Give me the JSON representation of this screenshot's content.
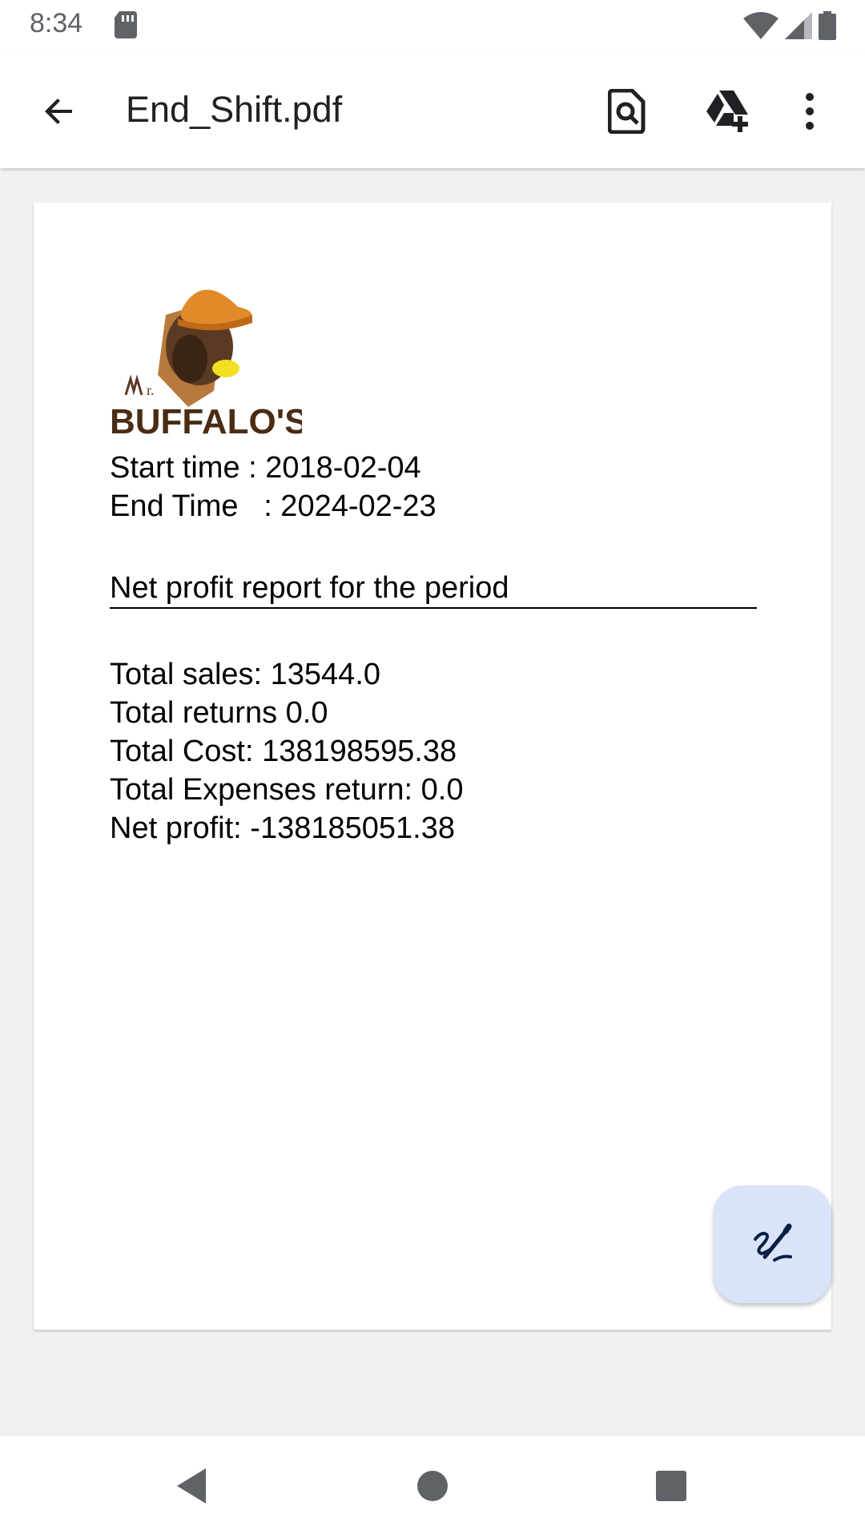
{
  "status_bar": {
    "time": "8:34",
    "icons": [
      "sd-card-icon",
      "wifi-icon",
      "signal-icon",
      "battery-icon"
    ]
  },
  "app_bar": {
    "title": "End_Shift.pdf",
    "icons": [
      "back-arrow-icon",
      "find-in-page-icon",
      "add-to-drive-icon",
      "more-vert-icon"
    ]
  },
  "document": {
    "logo_text": "Mr. BUFFALO'S",
    "start_time": "Start time : 2018-02-04",
    "end_time": "End Time   : 2024-02-23",
    "heading": "Net profit report for the period",
    "lines": [
      "Total sales: 13544.0",
      "Total returns 0.0",
      "Total Cost: 138198595.38",
      "Total Expenses return: 0.0",
      "Net profit: -138185051.38"
    ]
  },
  "fab": {
    "icon": "edit-annotate-icon"
  },
  "nav_bar": {
    "icons": [
      "nav-back-icon",
      "nav-home-icon",
      "nav-recents-icon"
    ]
  },
  "colors": {
    "status_text": "#5f6368",
    "title_text": "#202124",
    "viewer_bg": "#f1f1f1",
    "fab_bg": "#d9e4fb",
    "fab_icon": "#0b1f44",
    "nav_icon": "#5f6368"
  }
}
